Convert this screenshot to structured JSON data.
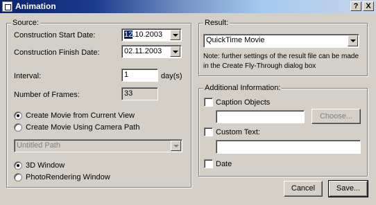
{
  "window": {
    "title": "Animation",
    "help_label": "?",
    "close_label": "X",
    "icon": "animation-app-icon"
  },
  "source": {
    "group_label": "Source:",
    "start_date_label": "Construction Start Date:",
    "start_date_day": "12",
    "start_date_rest": ".10.2003",
    "finish_date_label": "Construction Finish Date:",
    "finish_date_value": "02.11.2003",
    "interval_label": "Interval:",
    "interval_value": "1",
    "interval_unit": "day(s)",
    "frames_label": "Number of Frames:",
    "frames_value": "33",
    "movie_options": [
      {
        "label": "Create Movie from Current View",
        "checked": true
      },
      {
        "label": "Create Movie Using Camera Path",
        "checked": false
      }
    ],
    "path_value": "Untitled Path",
    "window_options": [
      {
        "label": "3D Window",
        "checked": true
      },
      {
        "label": "PhotoRendering Window",
        "checked": false
      }
    ]
  },
  "result": {
    "group_label": "Result:",
    "format_value": "QuickTime Movie",
    "note": "Note: further settings of the result file can be made in the Create Fly-Through dialog box"
  },
  "additional": {
    "group_label": "Additional Information:",
    "caption_label": "Caption Objects",
    "caption_checked": false,
    "caption_value": "",
    "choose_label": "Choose...",
    "custom_text_label": "Custom Text:",
    "custom_text_checked": false,
    "custom_text_value": "",
    "date_label": "Date",
    "date_checked": false
  },
  "footer": {
    "cancel_label": "Cancel",
    "save_label": "Save..."
  }
}
